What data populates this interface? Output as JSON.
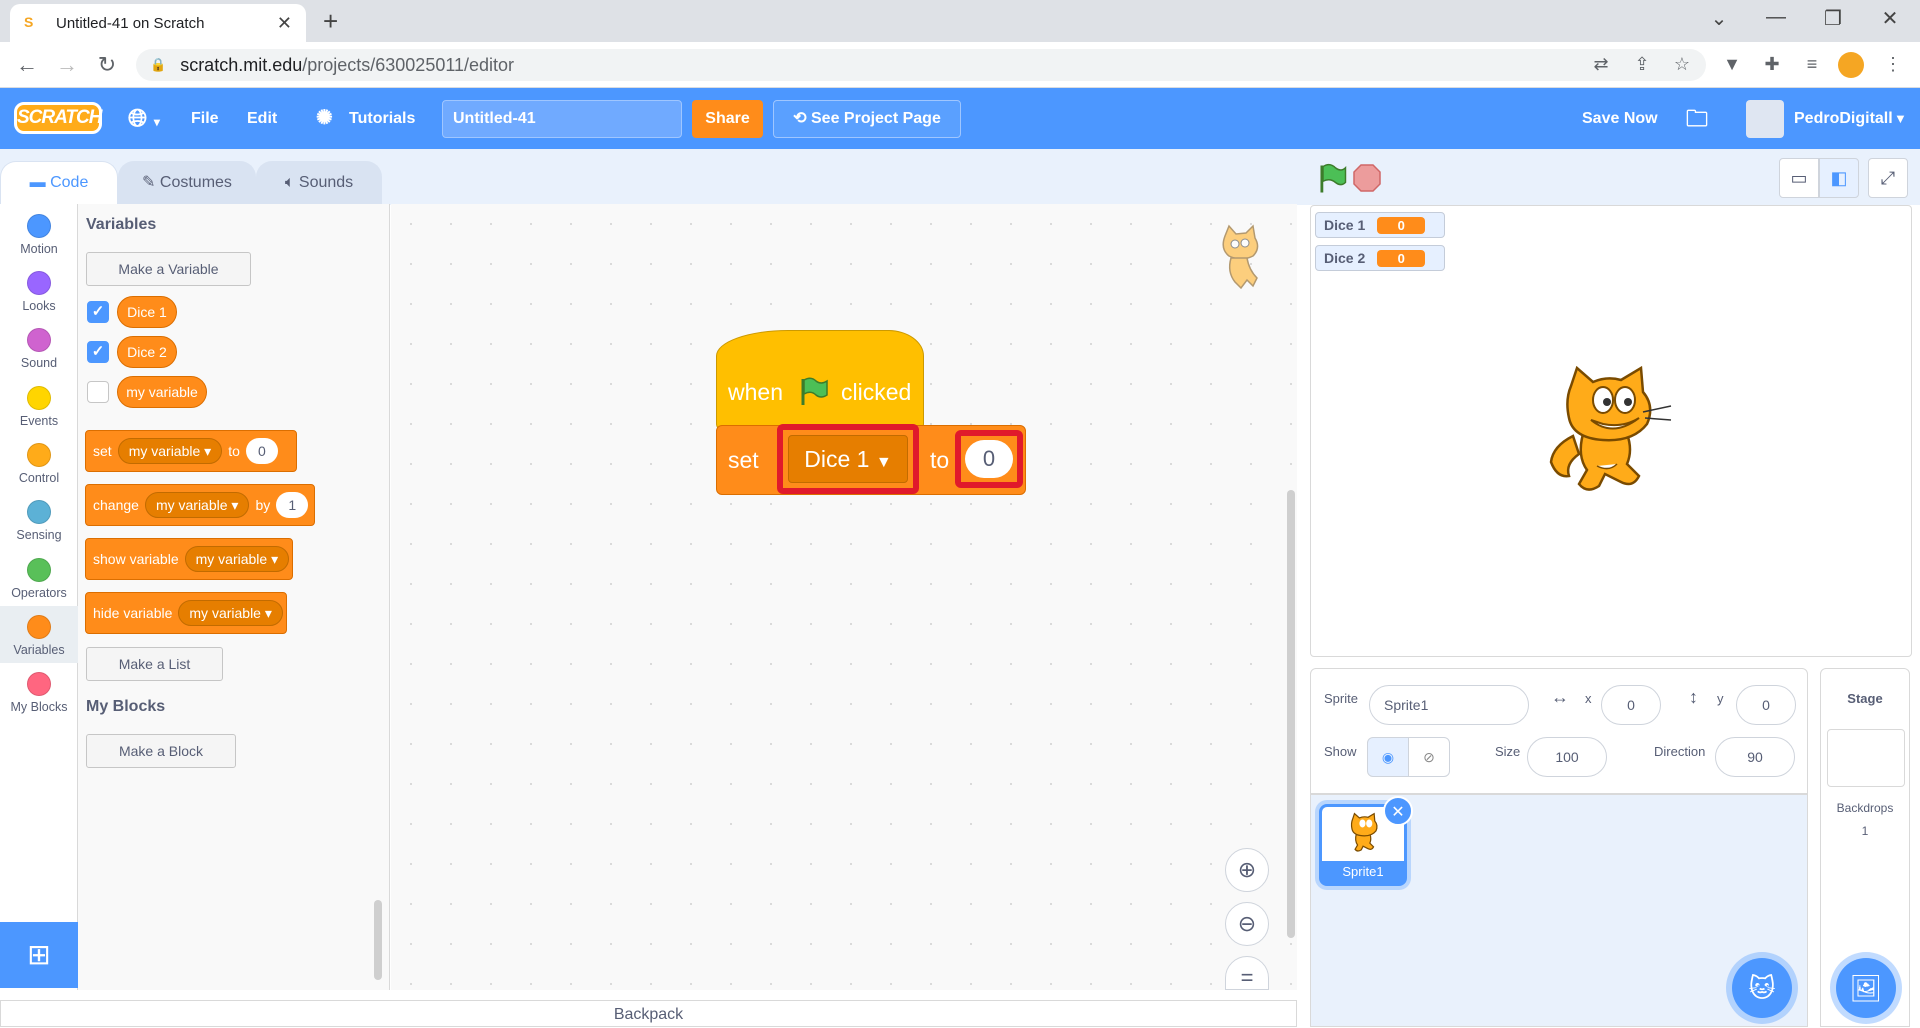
{
  "browser": {
    "tab_title": "Untitled-41 on Scratch",
    "favicon": "S",
    "close": "✕",
    "new_tab": "+",
    "url_host": "scratch.mit.edu",
    "url_path": "/projects/630025011/editor"
  },
  "menu": {
    "logo": "SCRATCH",
    "file": "File",
    "edit": "Edit",
    "tutorials": "Tutorials",
    "project_title": "Untitled-41",
    "share": "Share",
    "see_project_page": "See Project Page",
    "save_now": "Save Now",
    "username": "PedroDigitall"
  },
  "tabs": {
    "code": "Code",
    "costumes": "Costumes",
    "sounds": "Sounds"
  },
  "categories": [
    {
      "label": "Motion",
      "color": "#4c97ff"
    },
    {
      "label": "Looks",
      "color": "#9966ff"
    },
    {
      "label": "Sound",
      "color": "#cf63cf"
    },
    {
      "label": "Events",
      "color": "#ffd500"
    },
    {
      "label": "Control",
      "color": "#ffab19"
    },
    {
      "label": "Sensing",
      "color": "#5cb1d6"
    },
    {
      "label": "Operators",
      "color": "#59c059"
    },
    {
      "label": "Variables",
      "color": "#ff8c1a"
    },
    {
      "label": "My Blocks",
      "color": "#ff6680"
    }
  ],
  "palette": {
    "variables_heading": "Variables",
    "make_variable": "Make a Variable",
    "vars": [
      "Dice 1",
      "Dice 2",
      "my variable"
    ],
    "set_block": {
      "word": "set",
      "var": "my variable",
      "to": "to",
      "value": "0"
    },
    "change_block": {
      "word": "change",
      "var": "my variable",
      "by": "by",
      "value": "1"
    },
    "show_block": {
      "word": "show variable",
      "var": "my variable"
    },
    "hide_block": {
      "word": "hide variable",
      "var": "my variable"
    },
    "make_list": "Make a List",
    "myblocks_heading": "My Blocks",
    "make_block": "Make a Block"
  },
  "script": {
    "hat_when": "when",
    "hat_clicked": "clicked",
    "set_word": "set",
    "set_var": "Dice 1",
    "set_to": "to",
    "set_value": "0"
  },
  "backpack": "Backpack",
  "stage": {
    "monitors": [
      {
        "label": "Dice 1",
        "value": "0"
      },
      {
        "label": "Dice 2",
        "value": "0"
      }
    ]
  },
  "sprite_info": {
    "sprite_label": "Sprite",
    "sprite_name": "Sprite1",
    "x_label": "x",
    "x_value": "0",
    "y_label": "y",
    "y_value": "0",
    "show_label": "Show",
    "size_label": "Size",
    "size_value": "100",
    "direction_label": "Direction",
    "direction_value": "90"
  },
  "sprite_list": [
    {
      "name": "Sprite1"
    }
  ],
  "stage_pane": {
    "title": "Stage",
    "backdrops_label": "Backdrops",
    "backdrops_count": "1"
  }
}
